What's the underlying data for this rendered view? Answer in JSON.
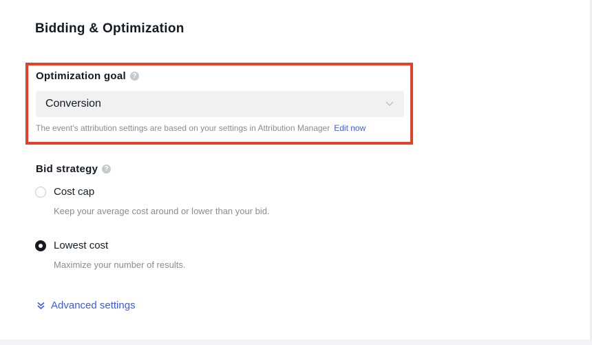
{
  "section": {
    "title": "Bidding & Optimization"
  },
  "optimization_goal": {
    "label": "Optimization goal",
    "help_icon": "question-circle-icon",
    "selected_value": "Conversion",
    "hint": "The event's attribution settings are based on your settings in Attribution Manager",
    "link": "Edit now",
    "highlight_color": "#e4412b"
  },
  "bid_strategy": {
    "label": "Bid strategy",
    "help_icon": "question-circle-icon",
    "options": [
      {
        "label": "Cost cap",
        "description": "Keep your average cost around or lower than your bid.",
        "selected": false
      },
      {
        "label": "Lowest cost",
        "description": "Maximize your number of results.",
        "selected": true
      }
    ]
  },
  "advanced_settings": {
    "label": "Advanced settings",
    "icon": "double-chevron-down-icon"
  },
  "colors": {
    "accent": "#3b5bdb",
    "text": "#161823",
    "muted": "#8a8b91",
    "select_bg": "#f1f1f2"
  }
}
